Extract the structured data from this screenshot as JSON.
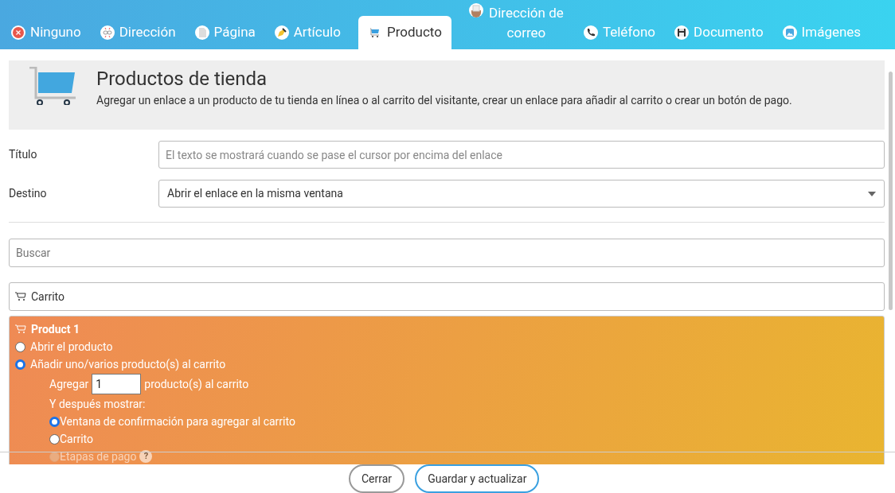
{
  "tabs": [
    {
      "label": "Ninguno",
      "selected": false
    },
    {
      "label": "Dirección",
      "selected": false
    },
    {
      "label": "Página",
      "selected": false
    },
    {
      "label": "Artículo",
      "selected": false
    },
    {
      "label": "Producto",
      "selected": true
    },
    {
      "label": "Dirección de correo",
      "selected": false
    },
    {
      "label": "Teléfono",
      "selected": false
    },
    {
      "label": "Documento",
      "selected": false
    },
    {
      "label": "Imágenes",
      "selected": false
    }
  ],
  "header": {
    "title": "Productos de tienda",
    "description": "Agregar un enlace a un producto de tu tienda en línea o al carrito del visitante, crear un enlace para añadir al carrito o crear un botón de pago."
  },
  "fields": [
    {
      "label": "Título",
      "kind": "text",
      "placeholder": "El texto se mostrará cuando se pase el cursor por encima del enlace"
    },
    {
      "label": "Destino",
      "kind": "select",
      "value": "Abrir el enlace en la misma ventana"
    }
  ],
  "search": {
    "placeholder": "Buscar"
  },
  "cart_item": {
    "label": "Carrito"
  },
  "product": {
    "name": "Product 1",
    "options": [
      {
        "label": "Abrir el producto",
        "selected": false
      },
      {
        "label": "Añadir uno/varios producto(s) al carrito",
        "selected": true
      }
    ],
    "quantity_prefix": "Agregar",
    "quantity": "1",
    "quantity_suffix": "producto(s) al carrito",
    "then_label": "Y después mostrar:",
    "then_options": [
      {
        "label": "Ventana de confirmación para agregar al carrito",
        "selected": true,
        "disabled": false
      },
      {
        "label": "Carrito",
        "selected": false,
        "disabled": false
      },
      {
        "label": "Etapas de pago",
        "selected": false,
        "disabled": true,
        "help": "?"
      }
    ]
  },
  "buttons": [
    {
      "label": "Cerrar",
      "kind": "secondary"
    },
    {
      "label": "Guardar y actualizar",
      "kind": "primary"
    }
  ]
}
